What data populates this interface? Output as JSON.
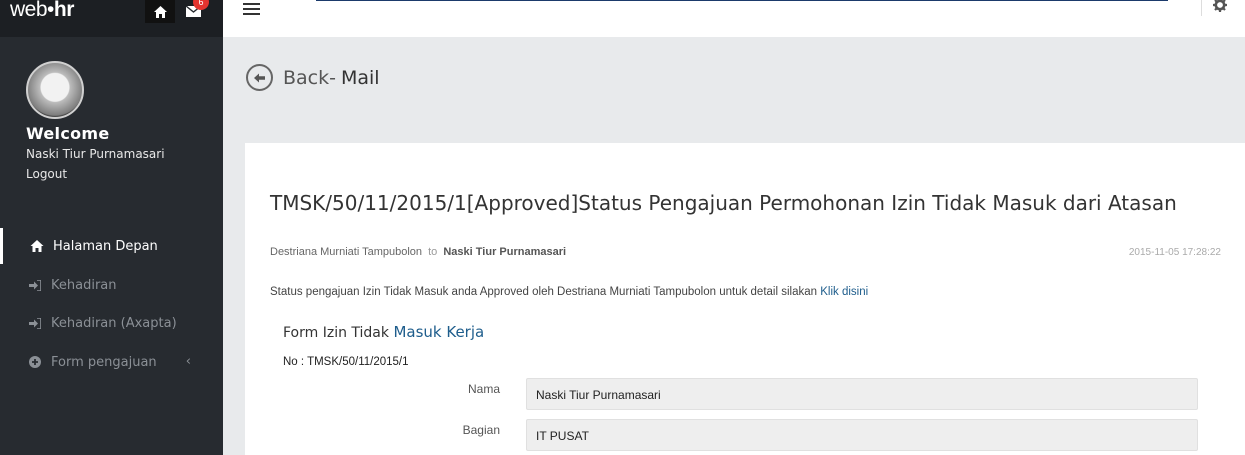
{
  "brand": {
    "logo_light": "web",
    "logo_dot": "•",
    "logo_bold": "hr",
    "mail_badge": "6"
  },
  "sidebar": {
    "welcome": "Welcome",
    "user_name": "Naski Tiur Purnamasari",
    "logout": "Logout",
    "items": [
      {
        "label": "Halaman Depan",
        "icon": "home-icon",
        "active": true
      },
      {
        "label": "Kehadiran",
        "icon": "sign-in-icon"
      },
      {
        "label": "Kehadiran (Axapta)",
        "icon": "sign-in-icon"
      },
      {
        "label": "Form pengajuan",
        "icon": "plus-circle-icon",
        "chevron": "‹"
      }
    ]
  },
  "header": {
    "back_label": "Back-",
    "title": "Mail"
  },
  "mail": {
    "subject": "TMSK/50/11/2015/1[Approved]Status Pengajuan Permohonan Izin Tidak Masuk dari Atasan",
    "sender": "Destriana Murniati Tampubolon",
    "to_word": "to",
    "recipient": "Naski Tiur Purnamasari",
    "date": "2015-11-05 17:28:22",
    "body": "Status pengajuan Izin Tidak Masuk anda Approved oleh Destriana Murniati Tampubolon untuk detail silakan",
    "link": "Klik disini",
    "form_title_plain": "Form Izin Tidak",
    "form_title_blue": "Masuk Kerja",
    "form_no": "No : TMSK/50/11/2015/1",
    "fields": [
      {
        "label": "Nama",
        "value": "Naski Tiur Purnamasari"
      },
      {
        "label": "Bagian",
        "value": "IT PUSAT"
      }
    ]
  },
  "colors": {
    "sidebar": "#272b30",
    "accent": "#1e5d8c",
    "badge": "#e3342f"
  }
}
